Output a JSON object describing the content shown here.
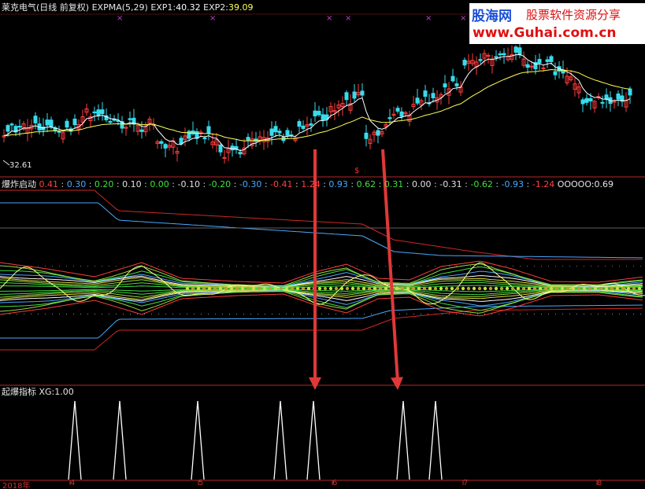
{
  "watermark": {
    "brand": "股海网",
    "slogan": "股票软件资源分享",
    "url": "www.Guhai.com.cn"
  },
  "panel1": {
    "stock_name": "莱克电气",
    "period": "(日线 前复权)",
    "indicator": "EXPMA(5,29)",
    "exp1_label": "EXP1:",
    "exp1_value": "40.32",
    "exp2_label": "EXP2:",
    "exp2_value": "39.09",
    "low_marker": "32.61",
    "signal_mark": "$"
  },
  "panel2": {
    "title": "爆炸启动",
    "levels": [
      "0.41",
      "0.30",
      "0.20",
      "0.10",
      "0.00",
      "-0.10",
      "-0.20",
      "-0.30",
      "-0.41",
      "1.24",
      "0.93",
      "0.62",
      "0.31",
      "0.00",
      "-0.31",
      "-0.62",
      "-0.93",
      "-1.24"
    ],
    "level_colors": [
      "#ff4040",
      "#4aa8ff",
      "#40e040",
      "#e0e0e0",
      "#40e040",
      "#e0e0e0",
      "#40e040",
      "#4aa8ff",
      "#ff4040",
      "#ff4040",
      "#4aa8ff",
      "#40e040",
      "#40e040",
      "#e0e0e0",
      "#e0e0e0",
      "#40e040",
      "#4aa8ff",
      "#ff4040"
    ],
    "extra_label": "OOOOO:",
    "extra_value": "0.69"
  },
  "panel3": {
    "title": "起爆指标",
    "xg_label": "XG:",
    "xg_value": "1.00"
  },
  "x_axis": {
    "year": "2018年",
    "months": [
      "4",
      "5",
      "6",
      "7",
      "8"
    ]
  },
  "chart_data": [
    {
      "type": "candlestick",
      "title": "莱克电气(日线 前复权)",
      "series": [
        {
          "name": "EXP1",
          "last": 40.32
        },
        {
          "name": "EXP2",
          "last": 39.09
        }
      ],
      "annotations": [
        {
          "text": "32.61",
          "meaning": "period low"
        }
      ],
      "x_ticks": [
        "4",
        "5",
        "6",
        "7",
        "8"
      ],
      "colors": {
        "up": "#ff3c3c",
        "down": "#37dcec",
        "exp1": "#ffffff",
        "exp2": "#ffff55"
      }
    },
    {
      "type": "line",
      "title": "爆炸启动",
      "levels": [
        0.41,
        0.3,
        0.2,
        0.1,
        0.0,
        -0.1,
        -0.2,
        -0.3,
        -0.41,
        1.24,
        0.93,
        0.62,
        0.31,
        0.0,
        -0.31,
        -0.62,
        -0.93,
        -1.24
      ],
      "OOOOO": 0.69
    },
    {
      "type": "line",
      "title": "起爆指标",
      "series": [
        {
          "name": "XG",
          "last": 1.0,
          "signal_count": 7
        }
      ],
      "ylim": [
        0,
        1
      ]
    }
  ]
}
